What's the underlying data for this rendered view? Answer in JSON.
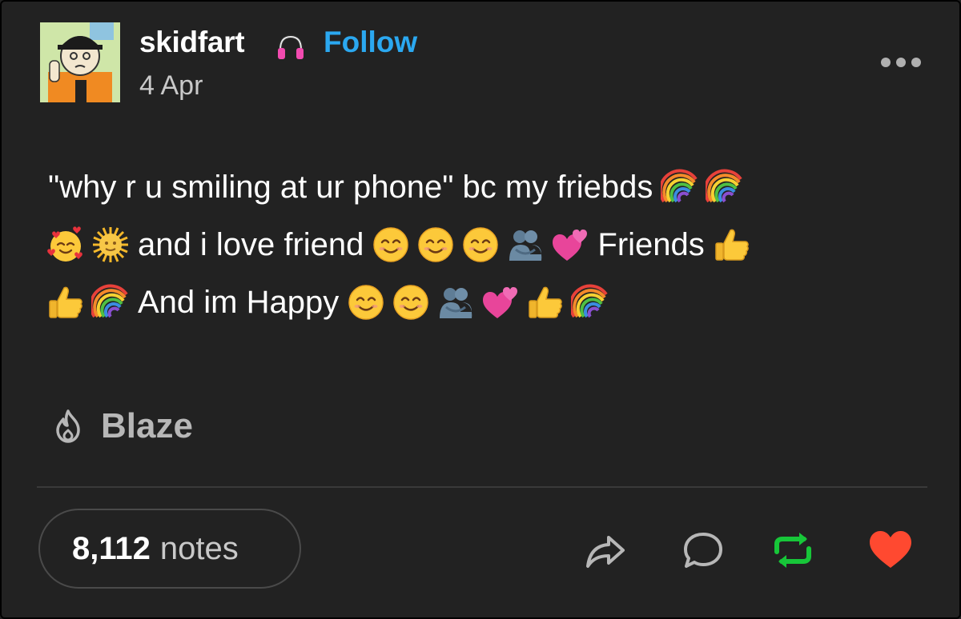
{
  "post": {
    "author": "skidfart",
    "follow_label": "Follow",
    "date": "4 Apr",
    "lines": [
      [
        "\"why r u smiling at ur phone\" bc my friebds",
        "rainbow",
        "rainbow"
      ],
      [
        "smiling-hearts",
        "sun-with-face",
        "and i love friend",
        "smile",
        "smile",
        "smile",
        "hug",
        "two-hearts",
        "Friends",
        "thumbs-up"
      ],
      [
        "thumbs-up",
        "rainbow",
        "And im Happy",
        "smile",
        "smile",
        "hug",
        "two-hearts",
        "thumbs-up",
        "rainbow"
      ]
    ]
  },
  "blaze": {
    "label": "Blaze",
    "icon": "flame-icon"
  },
  "footer": {
    "notes_count": "8,112",
    "notes_label": "notes",
    "actions": [
      "share-icon",
      "reply-icon",
      "reblog-icon",
      "like-icon"
    ]
  },
  "colors": {
    "background": "#222222",
    "follow": "#2ba8f0",
    "reblog": "#17c639",
    "like": "#ff4930",
    "muted": "#b7b7b7"
  }
}
